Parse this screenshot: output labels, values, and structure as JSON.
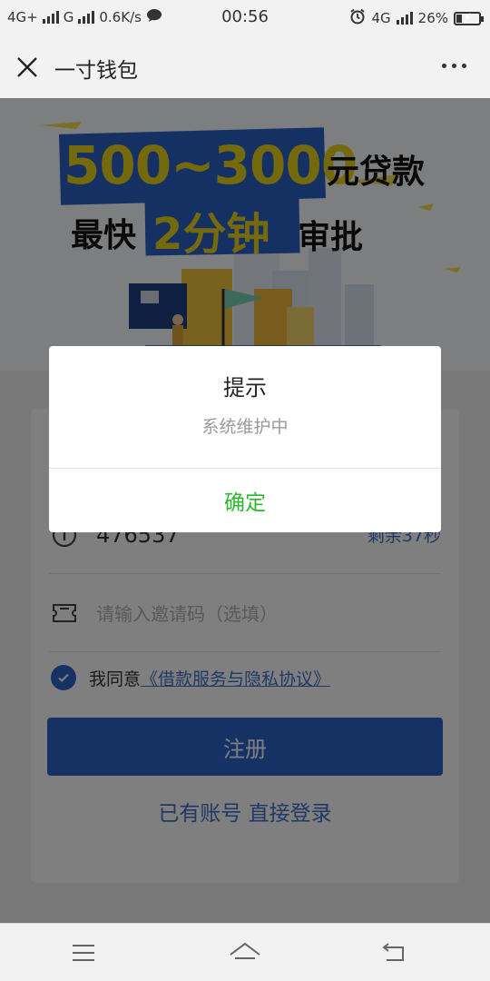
{
  "status_bar": {
    "network1": "4G+",
    "network2": "G",
    "speed": "0.6K/s",
    "time": "00:56",
    "network3": "4G",
    "battery": "26%",
    "battery_level": 0.26
  },
  "header": {
    "title": "一寸钱包"
  },
  "banner": {
    "amount": "500~3000",
    "amount_suffix": "元贷款",
    "fast": "最快",
    "minutes": "2分钟",
    "approve": "审批"
  },
  "form": {
    "code_value": "476537",
    "countdown": "剩余37秒",
    "invite_placeholder": "请输入邀请码（选填）",
    "agree_prefix": "我同意",
    "agree_link": "《借款服务与隐私协议》",
    "register_label": "注册",
    "login_link": "已有账号 直接登录"
  },
  "dialog": {
    "title": "提示",
    "message": "系统维护中",
    "ok_label": "确定"
  },
  "colors": {
    "accent": "#2c63c8",
    "link": "#3f73c8",
    "ok": "#2eb82e",
    "banner_yellow": "#e8d31a"
  }
}
